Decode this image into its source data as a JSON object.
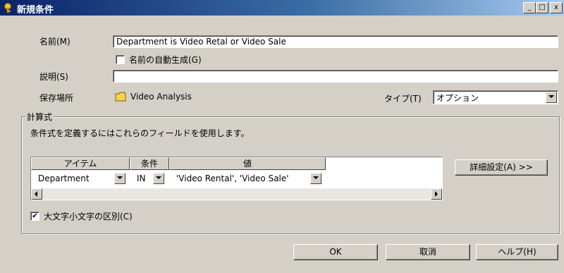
{
  "window": {
    "title": "新規条件",
    "min_label": "_",
    "max_label": "□",
    "close_label": "x"
  },
  "form": {
    "name_label": "名前(M)",
    "name_value": "Department is Video Retal or Video Sale",
    "auto_name_label": "名前の自動生成(G)",
    "auto_name_checked": false,
    "desc_label": "説明(S)",
    "desc_value": "",
    "location_label": "保存場所",
    "location_value": "Video Analysis",
    "type_label": "タイプ(T)",
    "type_value": "オプション"
  },
  "calc": {
    "group_label": "計算式",
    "instruction": "条件式を定義するにはこれらのフィールドを使用します。",
    "columns": [
      "アイテム",
      "条件",
      "値"
    ],
    "rows": [
      {
        "item": "Department",
        "condition": "IN",
        "value": "'Video Rental', 'Video Sale'"
      }
    ],
    "advanced_button": "詳細設定(A) >>",
    "case_sensitive_label": "大文字小文字の区別(C)",
    "case_sensitive_checked": true
  },
  "buttons": {
    "ok": "OK",
    "cancel": "取消",
    "help": "ヘルプ(H)"
  },
  "icons": {
    "title": "key-icon",
    "folder": "folder-icon",
    "check": "check-icon"
  }
}
